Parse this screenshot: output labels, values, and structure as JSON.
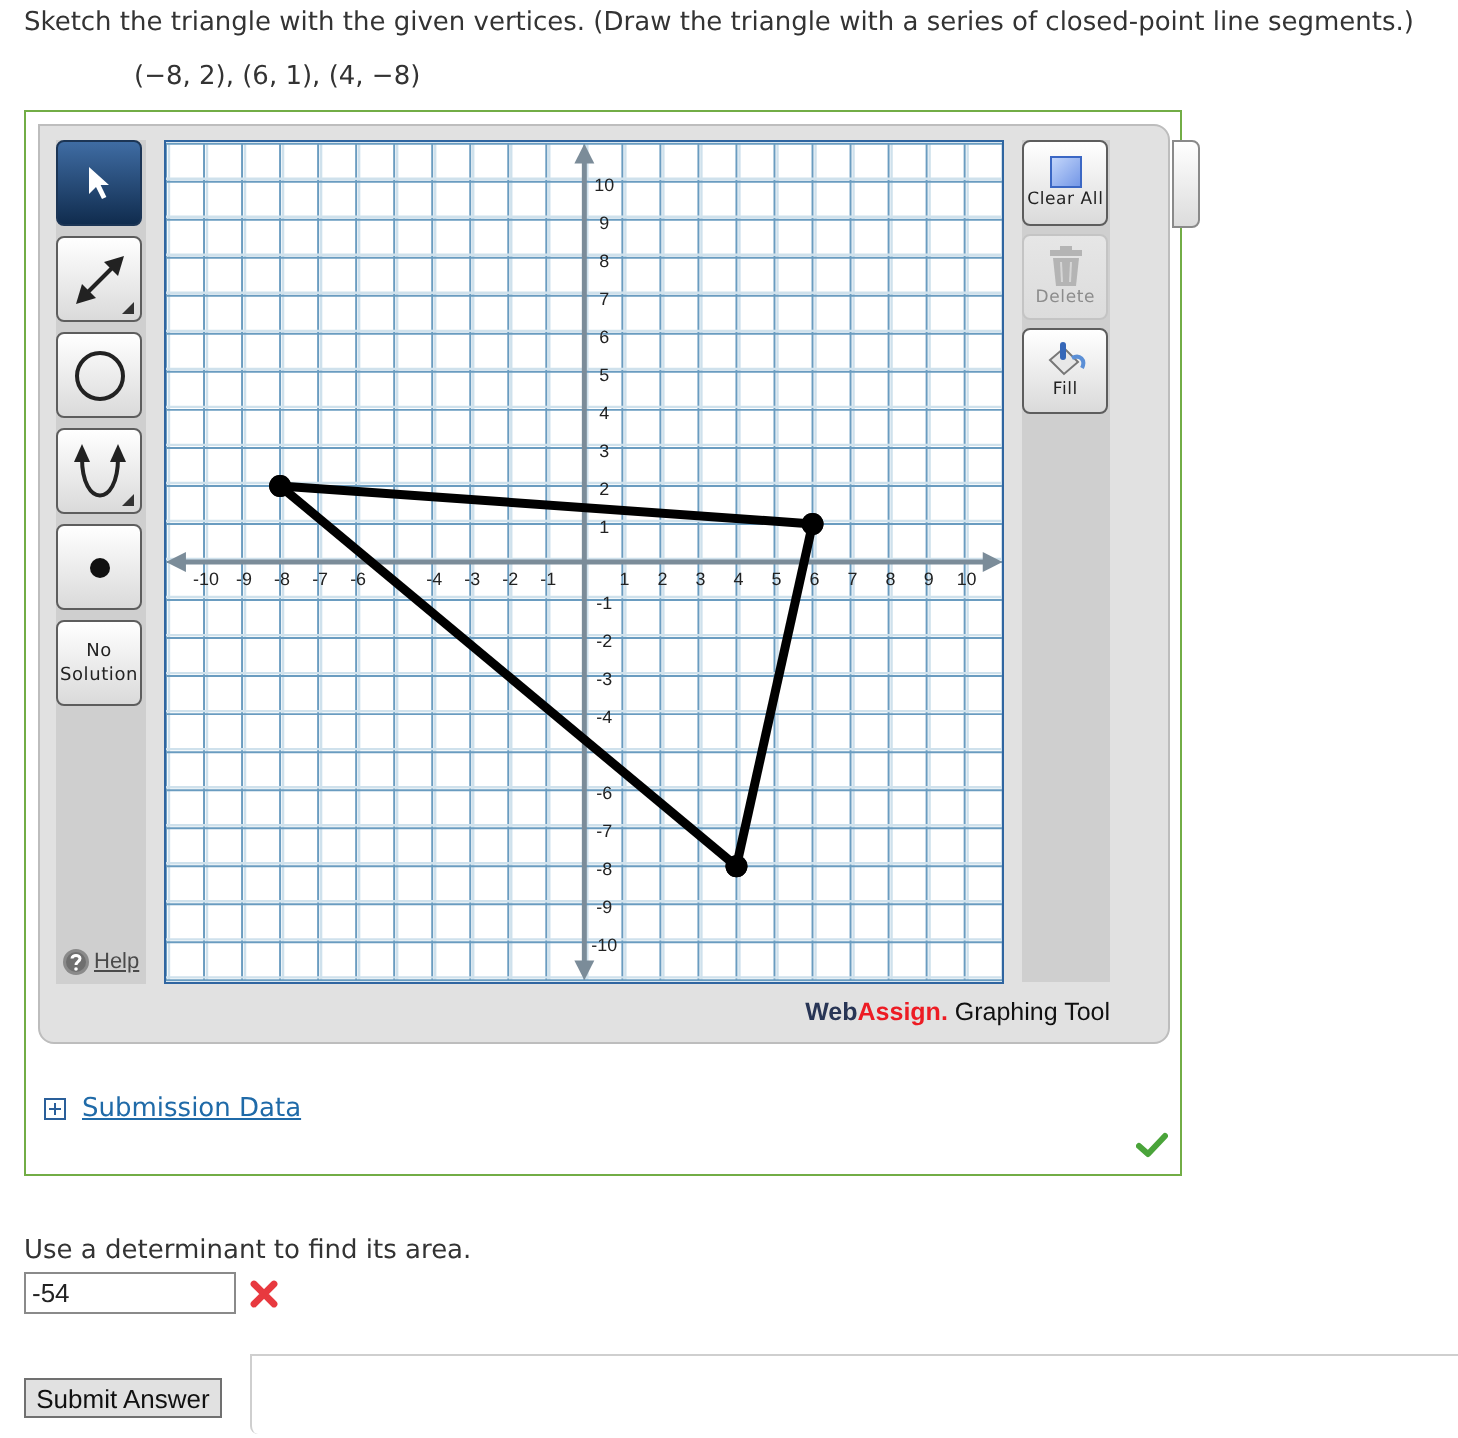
{
  "question": {
    "text": "Sketch the triangle with the given vertices. (Draw the triangle with a series of closed-point line segments.)",
    "vertices": "(−8, 2), (6, 1), (4, −8)"
  },
  "graph_tool": {
    "correct": true,
    "left_tools": [
      {
        "kind": "pointer",
        "selected": true,
        "submenu": false
      },
      {
        "kind": "line",
        "selected": false,
        "submenu": true
      },
      {
        "kind": "circle",
        "selected": false,
        "submenu": false
      },
      {
        "kind": "parabola",
        "selected": false,
        "submenu": true
      },
      {
        "kind": "point",
        "selected": false,
        "submenu": false
      },
      {
        "kind": "text",
        "label": "No Solution",
        "selected": false,
        "submenu": false
      }
    ],
    "help": "Help",
    "chart_data": {
      "type": "line",
      "x": [
        -8,
        6,
        4,
        -8
      ],
      "series": [
        {
          "color": "#000000",
          "values": [
            2,
            1,
            null,
            null
          ]
        },
        {
          "color": "#000000",
          "values": [
            null,
            1,
            -8,
            null
          ]
        },
        {
          "color": "#000000",
          "values": [
            null,
            null,
            -8,
            2
          ]
        }
      ],
      "xlim": [
        -11,
        11
      ],
      "ylim": [
        -11,
        11
      ],
      "xticks": [
        -10,
        -9,
        -8,
        -7,
        -6,
        -4,
        -3,
        -2,
        -1,
        1,
        2,
        3,
        4,
        5,
        6,
        7,
        8,
        9,
        10
      ],
      "yticks": [
        -10,
        -9,
        -8,
        -7,
        -6,
        -4,
        -3,
        -2,
        -1,
        1,
        2,
        3,
        4,
        5,
        6,
        7,
        8,
        9,
        10
      ],
      "grid": true
    },
    "right_tools": [
      {
        "kind": "clear",
        "label": "Clear All",
        "disabled": false
      },
      {
        "kind": "delete",
        "label": "Delete",
        "disabled": true
      },
      {
        "kind": "fill",
        "label": "Fill",
        "disabled": false
      }
    ],
    "branding": {
      "brand_first": "Web",
      "brand_second": "Assign.",
      "product": "Graphing Tool"
    },
    "submission_data": {
      "label": "Submission Data",
      "expanded": false
    }
  },
  "answer": {
    "prompt": "Use a determinant to find its area.",
    "value": "-54",
    "correct": false
  },
  "submit": "Submit Answer"
}
